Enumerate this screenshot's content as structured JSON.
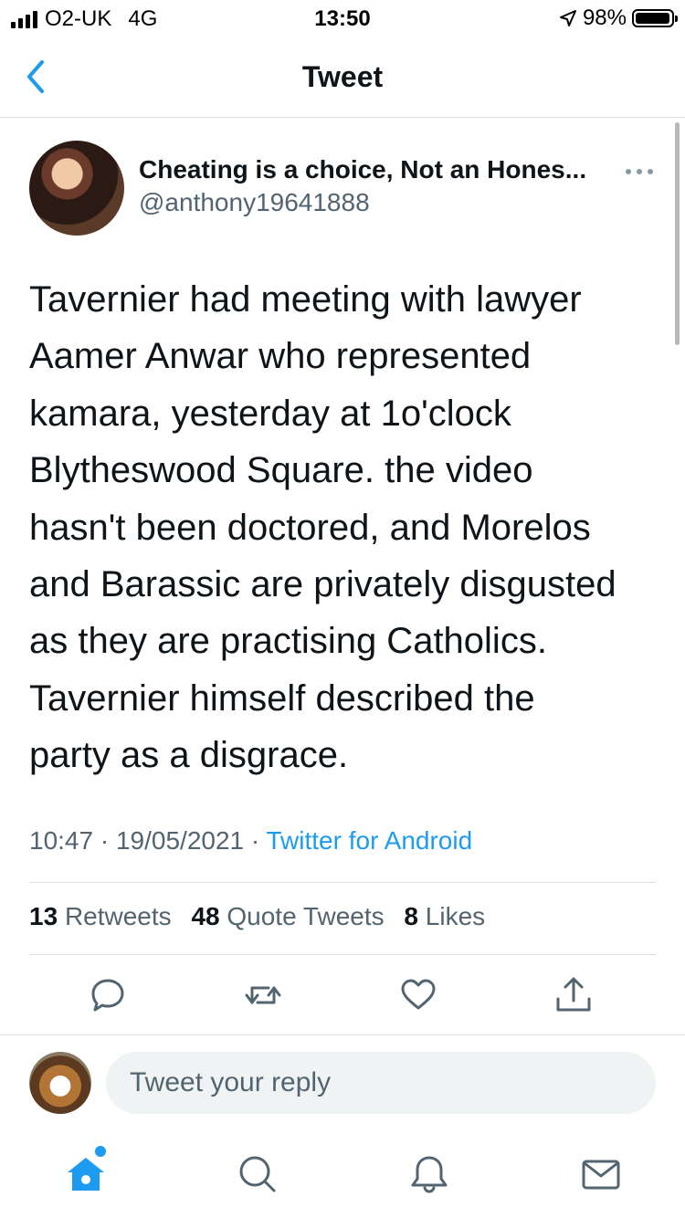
{
  "status_bar": {
    "carrier": "O2-UK",
    "network": "4G",
    "time": "13:50",
    "battery": "98%",
    "battery_level": 0.98
  },
  "header": {
    "title": "Tweet"
  },
  "tweet": {
    "author_name": "Cheating is a choice, Not an Hones...",
    "author_handle": "@anthony19641888",
    "text": "Tavernier had meeting with  lawyer\nAamer Anwar who represented\nkamara, yesterday at 1o'clock\nBlytheswood Square. the video\nhasn't been doctored, and Morelos\nand Barassic are privately disgusted\nas they are practising Catholics.\nTavernier himself described the\nparty as a disgrace.",
    "time": "10:47",
    "date": "19/05/2021",
    "source": "Twitter for Android",
    "stats": {
      "retweets_count": "13",
      "retweets_label": "Retweets",
      "quotes_count": "48",
      "quotes_label": "Quote Tweets",
      "likes_count": "8",
      "likes_label": "Likes"
    }
  },
  "reply": {
    "placeholder": "Tweet your reply"
  },
  "colors": {
    "accent": "#1d9bf0",
    "secondary_text": "#536471",
    "divider": "#d9dfe3"
  },
  "icons": {
    "back": "chevron-left-icon",
    "more": "more-horizontal-icon",
    "reply": "reply-icon",
    "retweet": "retweet-icon",
    "like": "heart-icon",
    "share": "share-icon",
    "tab_home": "home-icon",
    "tab_search": "search-icon",
    "tab_notifications": "bell-icon",
    "tab_messages": "mail-icon"
  }
}
